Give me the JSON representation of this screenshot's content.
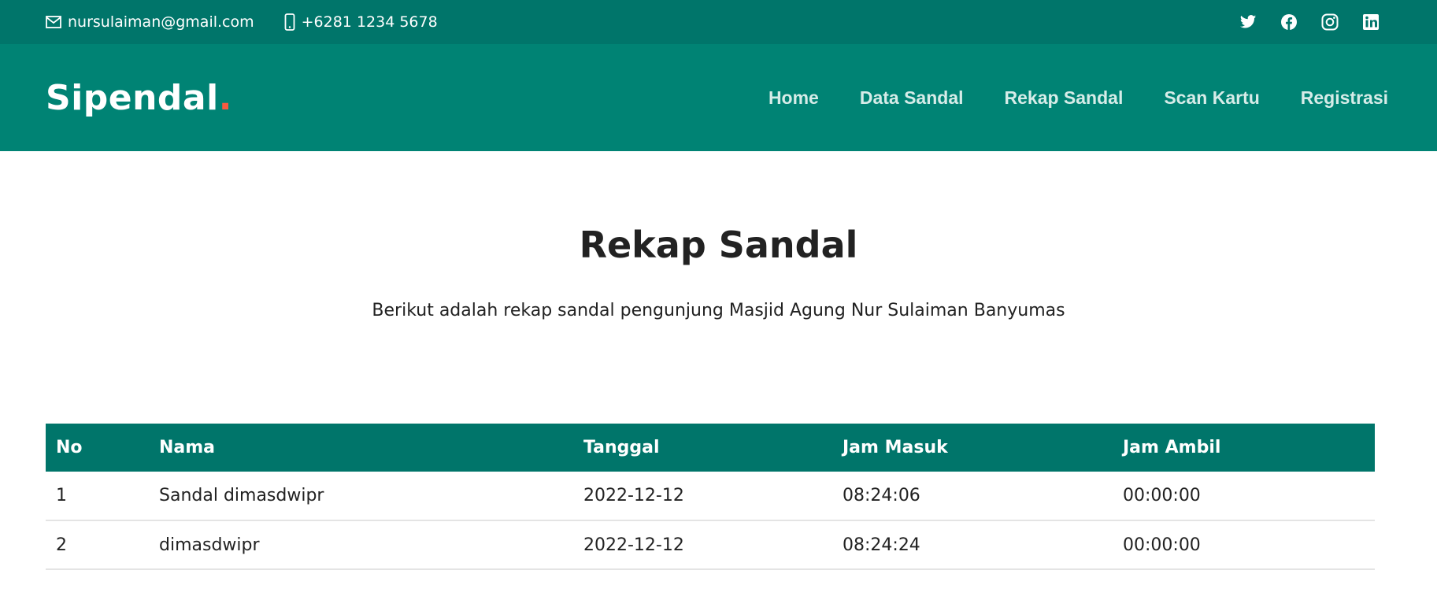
{
  "topbar": {
    "email": "nursulaiman@gmail.com",
    "phone": "+6281 1234 5678",
    "socials": [
      "twitter-icon",
      "facebook-icon",
      "instagram-icon",
      "linkedin-icon"
    ]
  },
  "navbar": {
    "brand": "Sipendal",
    "brand_dot": ".",
    "menu": [
      "Home",
      "Data Sandal",
      "Rekap Sandal",
      "Scan Kartu",
      "Registrasi"
    ]
  },
  "section": {
    "title": "Rekap Sandal",
    "subtitle": "Berikut adalah rekap sandal pengunjung Masjid Agung Nur Sulaiman Banyumas"
  },
  "table": {
    "headers": [
      "No",
      "Nama",
      "Tanggal",
      "Jam Masuk",
      "Jam Ambil"
    ],
    "rows": [
      [
        "1",
        "Sandal dimasdwipr",
        "2022-12-12",
        "08:24:06",
        "00:00:00"
      ],
      [
        "2",
        "dimasdwipr",
        "2022-12-12",
        "08:24:24",
        "00:00:00"
      ]
    ]
  },
  "colors": {
    "topbar": "#00756a",
    "navbar": "#008374",
    "accent": "#f85a40",
    "table_header": "#00756a"
  }
}
